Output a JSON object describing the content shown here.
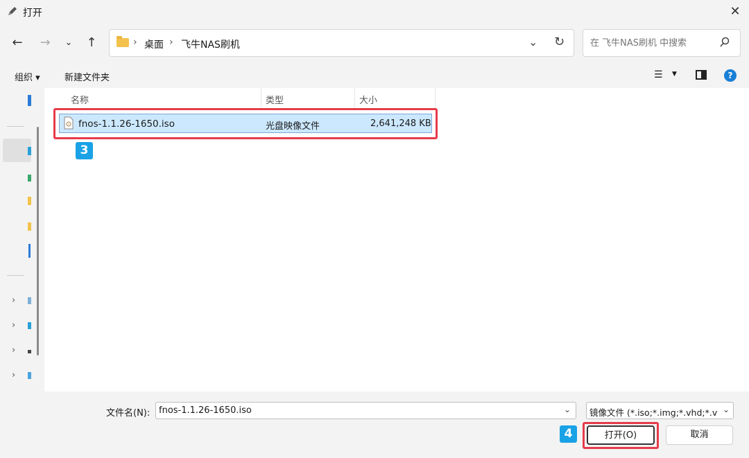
{
  "window": {
    "title": "打开"
  },
  "address": {
    "crumbs": [
      "桌面",
      "飞牛NAS刷机"
    ],
    "sep": "›"
  },
  "search": {
    "placeholder": "在 飞牛NAS刷机 中搜索"
  },
  "toolbar": {
    "organize": "组织 ▾",
    "new_folder": "新建文件夹"
  },
  "columns": {
    "name": "名称",
    "type": "类型",
    "size": "大小"
  },
  "files": [
    {
      "name": "fnos-1.1.26-1650.iso",
      "type": "光盘映像文件",
      "size": "2,641,248 KB"
    }
  ],
  "badges": {
    "step3": "3",
    "step4": "4"
  },
  "footer": {
    "filename_label": "文件名(N):",
    "filename_value": "fnos-1.1.26-1650.iso",
    "filetype": "镜像文件 (*.iso;*.img;*.vhd;*.v",
    "open": "打开(O)",
    "cancel": "取消"
  },
  "colors": {
    "accent": "#1aa2e6",
    "annotation": "#e63b4a",
    "selection": "#cce8ff"
  },
  "icons": [
    "app-pen-icon",
    "close-icon",
    "back-icon",
    "forward-icon",
    "chevron-down-icon",
    "up-icon",
    "folder-icon",
    "refresh-icon",
    "search-icon",
    "view-list-icon",
    "preview-pane-icon",
    "help-icon",
    "iso-file-icon"
  ]
}
